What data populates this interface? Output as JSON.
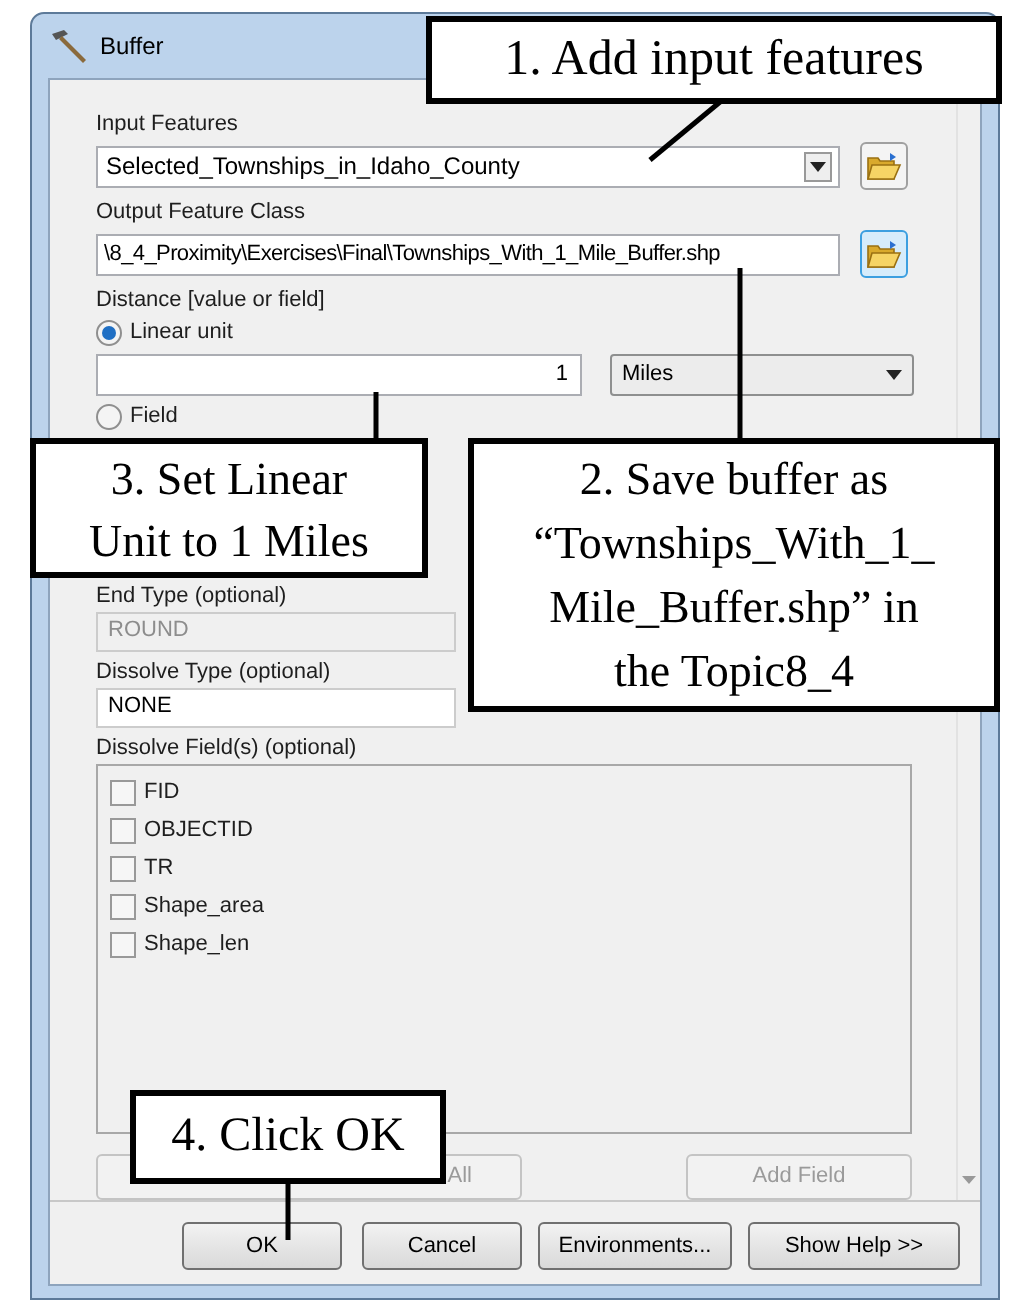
{
  "window": {
    "title": "Buffer"
  },
  "input_features": {
    "label": "Input Features",
    "value": "Selected_Townships_in_Idaho_County",
    "browse_highlighted": false
  },
  "output_feature_class": {
    "label": "Output Feature Class",
    "value": "\\8_4_Proximity\\Exercises\\Final\\Townships_With_1_Mile_Buffer.shp",
    "browse_highlighted": true
  },
  "distance": {
    "label": "Distance [value or field]",
    "options": [
      {
        "label": "Linear unit",
        "selected": true
      },
      {
        "label": "Field",
        "selected": false
      }
    ],
    "value": "1",
    "unit": "Miles"
  },
  "end_type": {
    "label": "End Type (optional)",
    "value": "ROUND",
    "disabled": true
  },
  "dissolve_type": {
    "label": "Dissolve Type (optional)",
    "value": "NONE",
    "disabled": false
  },
  "dissolve_fields": {
    "label": "Dissolve Field(s) (optional)",
    "items": [
      {
        "label": "FID",
        "checked": false
      },
      {
        "label": "OBJECTID",
        "checked": false
      },
      {
        "label": "TR",
        "checked": false
      },
      {
        "label": "Shape_area",
        "checked": false
      },
      {
        "label": "Shape_len",
        "checked": false
      }
    ]
  },
  "list_buttons": [
    {
      "label": "All",
      "disabled": true
    },
    {
      "label": "Add Field",
      "disabled": true
    }
  ],
  "buttons": [
    "OK",
    "Cancel",
    "Environments...",
    "Show Help >>"
  ],
  "callouts": [
    {
      "lines": [
        "1. Add input features"
      ]
    },
    {
      "lines": [
        "3. Set Linear",
        "Unit to 1 Miles"
      ]
    },
    {
      "lines": [
        "2. Save buffer as",
        "“Townships_With_1_",
        "Mile_Buffer.shp” in",
        "the Topic8_4"
      ]
    },
    {
      "lines": [
        "4. Click OK"
      ]
    }
  ]
}
